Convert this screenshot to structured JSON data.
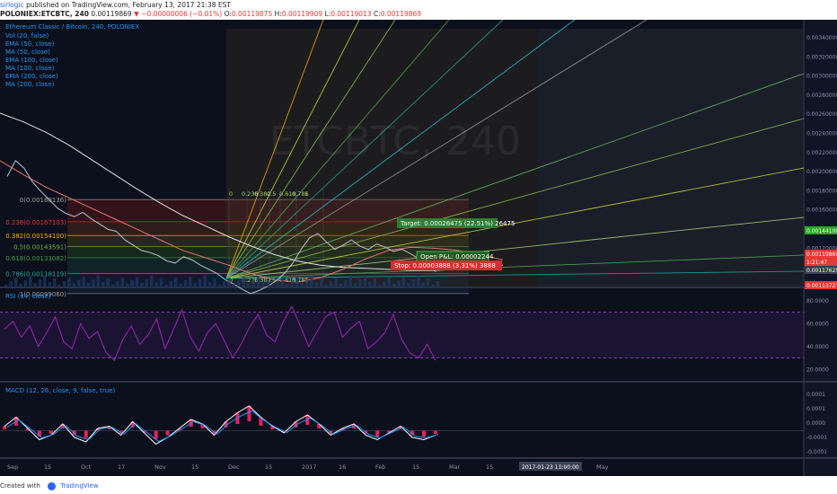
{
  "header": {
    "author": "sirlogic",
    "published": "published on TradingView.com, February 13, 2017 21:38 EST",
    "symbol": "POLONIEX:ETCBTC, 240",
    "last": "0.00119869",
    "change": "−0.00000006 (−0.01%)",
    "open": "0.00119875",
    "high": "0.00119909",
    "low": "0.00119013",
    "close": "0.00119869"
  },
  "watermark": "ETCBTC, 240",
  "legend": {
    "title": "Ethereum Classic / Bitcoin, 240, POLONIEX",
    "items": [
      "Vol (20, false)",
      "EMA (50, close)",
      "MA (50, close)",
      "EMA (100, close)",
      "MA (100, close)",
      "EMA (200, close)",
      "MA (200, close)"
    ]
  },
  "fib_levels": [
    {
      "label": "0(0.00188136)",
      "value": 0.00188136
    },
    {
      "label": "0.236(0.00167103)",
      "value": 0.00167103
    },
    {
      "label": "0.382(0.00154100)",
      "value": 0.001541
    },
    {
      "label": "0.5(0.00143591)",
      "value": 0.00143591
    },
    {
      "label": "0.618(0.00133082)",
      "value": 0.00133082
    },
    {
      "label": "0.786(0.00118119)",
      "value": 0.00118119
    },
    {
      "label": "1(0.00099060)",
      "value": 0.0009906
    }
  ],
  "fan_labels": [
    "0",
    "0.236",
    "0.382",
    "0.5",
    "0.618",
    "0.786",
    "1"
  ],
  "position": {
    "target": "Target: 0.00026475 (22.51%) 26475",
    "open_pl": "Open P&L: 0.00002244",
    "stop": "Stop: 0.00003888 (3.31%) 3888"
  },
  "price_axis": {
    "ticks": [
      "0.00340000",
      "0.00320000",
      "0.00300000",
      "0.00280000",
      "0.00260000",
      "0.00240000",
      "0.00220000",
      "0.00200000",
      "0.00180000",
      "0.00160000",
      "0.00140000",
      "0.00120000"
    ],
    "badges": [
      {
        "text": "0.00144100",
        "color": "#22aa22"
      },
      {
        "text": "0.00119869",
        "color": "#e53935"
      },
      {
        "text": "1:21:47",
        "color": "#e53935"
      },
      {
        "text": "0.00117625",
        "color": "#3a3f52"
      },
      {
        "text": "0.00113727",
        "color": "#e53935"
      }
    ]
  },
  "rsi": {
    "label": "RSI (14, close)",
    "ticks": [
      "80.0000",
      "60.0000",
      "40.0000",
      "20.0000"
    ],
    "upper": 70,
    "lower": 30
  },
  "macd": {
    "label": "MACD (12, 26, close, 9, false, true)",
    "ticks": [
      "0.0001",
      "0.0001",
      "0.0000",
      "-0.0001",
      "-0.0001"
    ]
  },
  "time_axis": {
    "labels": [
      "Sep",
      "15",
      "Oct",
      "17",
      "Nov",
      "15",
      "Dec",
      "15",
      "2017",
      "16",
      "Feb",
      "15",
      "Mar",
      "15",
      "2017-01-23 11:00:00",
      "17",
      "May"
    ],
    "crosshair": "2017-01-23 11:00:00"
  },
  "chart_data": {
    "type": "line",
    "title": "Ethereum Classic / Bitcoin, 240, POLONIEX",
    "ylim": [
      0.0011,
      0.0035
    ],
    "series": [
      {
        "name": "ETCBTC close",
        "values": [
          0.0021,
          0.00225,
          0.00218,
          0.00205,
          0.00196,
          0.00188,
          0.0018,
          0.00175,
          0.00172,
          0.00176,
          0.0017,
          0.00165,
          0.0016,
          0.00158,
          0.0015,
          0.00145,
          0.0014,
          0.00138,
          0.00135,
          0.0013,
          0.00128,
          0.00134,
          0.00131,
          0.00126,
          0.00122,
          0.00118,
          0.00112,
          0.00108,
          0.00103,
          0.00099,
          0.00102,
          0.00106,
          0.00111,
          0.00118,
          0.00128,
          0.00141,
          0.00152,
          0.00156,
          0.00148,
          0.00141,
          0.00145,
          0.0015,
          0.00144,
          0.00141,
          0.00146,
          0.00143,
          0.00139,
          0.00141,
          0.00137,
          0.00132,
          0.00126,
          0.0012
        ]
      },
      {
        "name": "MA (200, close)",
        "values": [
          0.0027,
          0.00262,
          0.00252,
          0.0024,
          0.00226,
          0.00212,
          0.00198,
          0.00185,
          0.00173,
          0.00163,
          0.00153,
          0.00144,
          0.00136,
          0.0013,
          0.00126,
          0.00124,
          0.00123,
          0.00122,
          0.00121,
          0.00121,
          0.00122,
          0.00124,
          0.00126
        ]
      },
      {
        "name": "EMA (50, close)",
        "values": [
          0.00225,
          0.00212,
          0.002,
          0.0019,
          0.0018,
          0.0017,
          0.0016,
          0.0015,
          0.0014,
          0.00133,
          0.00126,
          0.00118,
          0.00112,
          0.0011,
          0.00114,
          0.00122,
          0.00132,
          0.0014,
          0.00143,
          0.00142,
          0.0014,
          0.00136,
          0.00131
        ]
      }
    ],
    "rsi_values": [
      55,
      62,
      48,
      58,
      40,
      52,
      66,
      44,
      38,
      60,
      47,
      53,
      35,
      28,
      46,
      58,
      42,
      50,
      64,
      38,
      55,
      72,
      48,
      36,
      52,
      60,
      45,
      30,
      42,
      57,
      68,
      50,
      44,
      62,
      75,
      58,
      40,
      53,
      66,
      70,
      48,
      56,
      62,
      38,
      44,
      52,
      68,
      46,
      34,
      30,
      42,
      28
    ],
    "macd_values": [
      2e-05,
      6e-05,
      1e-05,
      -4e-05,
      -2e-05,
      3e-05,
      -3e-05,
      -5e-05,
      1e-05,
      2e-05,
      -2e-05,
      4e-05,
      -1e-05,
      -6e-05,
      -3e-05,
      1e-05,
      5e-05,
      3e-05,
      -2e-05,
      4e-05,
      8e-05,
      0.00011,
      6e-05,
      2e-05,
      -1e-05,
      4e-05,
      7e-05,
      3e-05,
      -2e-05,
      1e-05,
      3e-05,
      -2e-05,
      -4e-05,
      -1e-05,
      2e-05,
      -3e-05,
      -4e-05,
      -2e-05
    ],
    "colors": {
      "price": "#b0b7c3",
      "ma200": "#e0e0e0",
      "ema50": "#e57373",
      "rsi": "#9c27b0",
      "macd": "#ffffff",
      "signal": "#2196f3",
      "hist": "#e91e63"
    }
  },
  "footer": {
    "created": "Created with",
    "brand": "TradingView"
  }
}
